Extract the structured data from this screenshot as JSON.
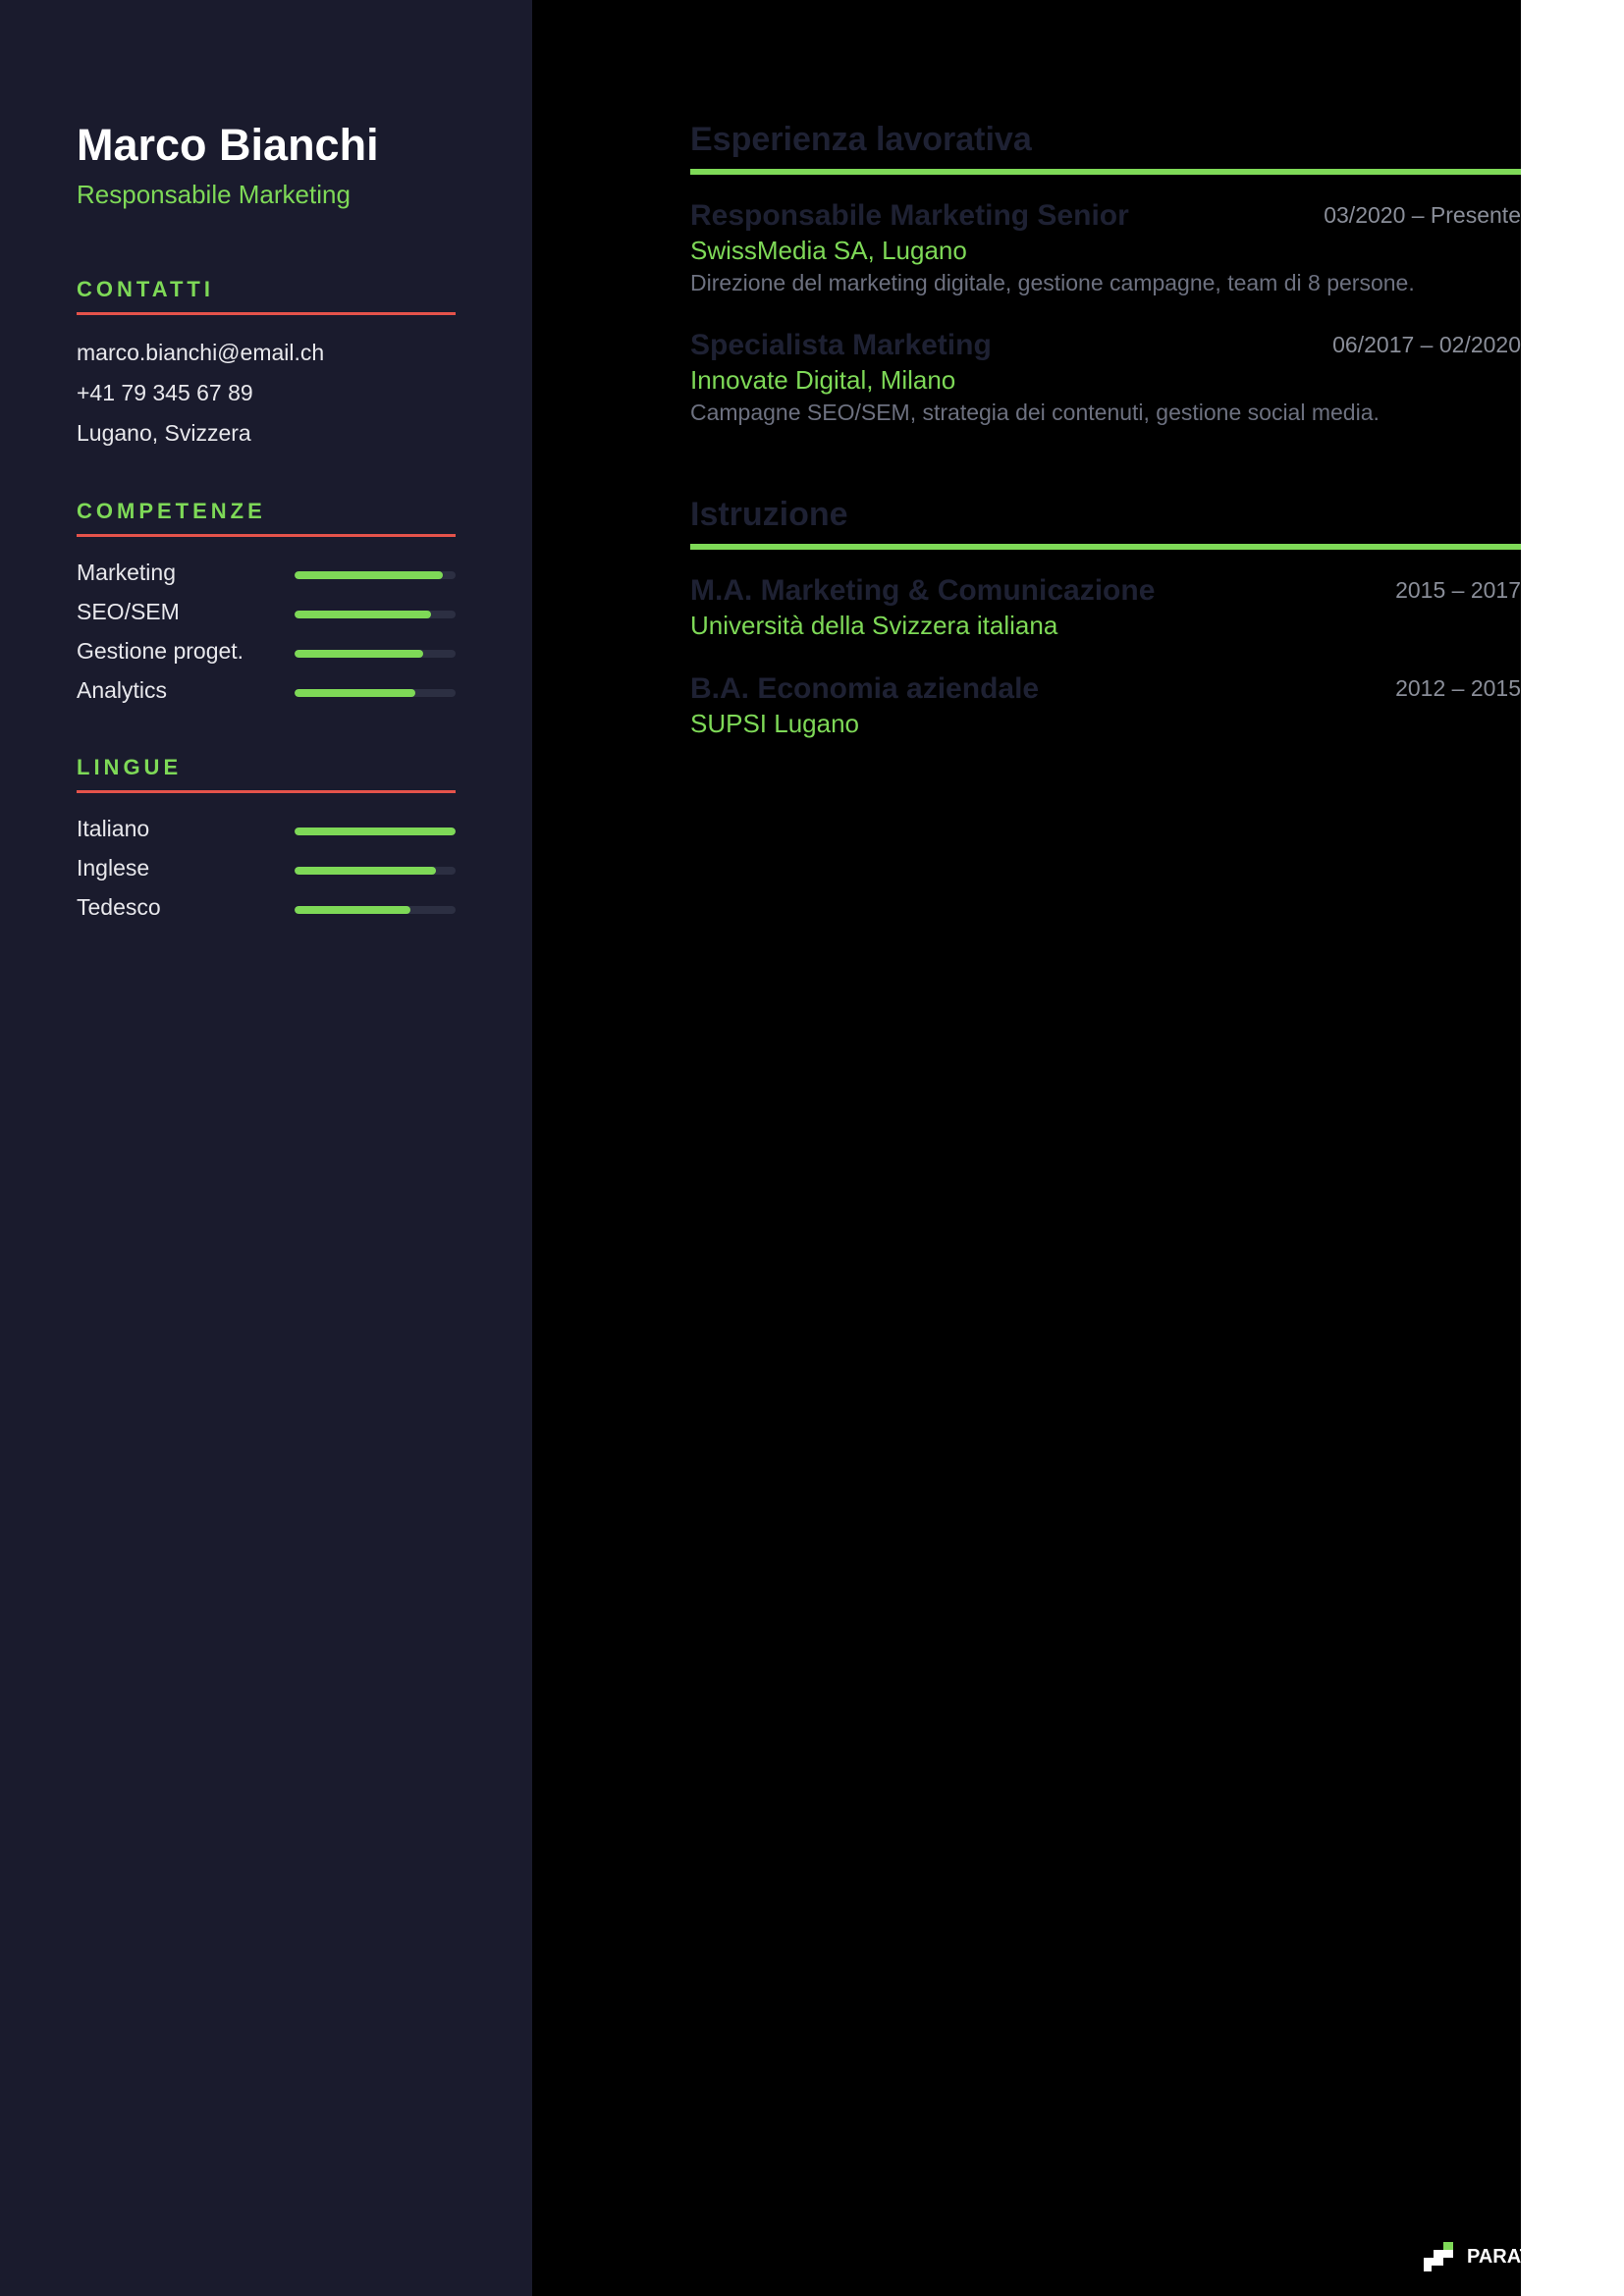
{
  "profile": {
    "name": "Marco Bianchi",
    "title": "Responsabile Marketing"
  },
  "contacts": {
    "heading": "CONTATTI",
    "email": "marco.bianchi@email.ch",
    "phone": "+41 79 345 67 89",
    "location": "Lugano, Svizzera"
  },
  "skills": {
    "heading": "COMPETENZE",
    "items": [
      {
        "label": "Marketing",
        "level": 0.92
      },
      {
        "label": "SEO/SEM",
        "level": 0.85
      },
      {
        "label": "Gestione proget.",
        "level": 0.8
      },
      {
        "label": "Analytics",
        "level": 0.75
      }
    ]
  },
  "languages": {
    "heading": "LINGUE",
    "items": [
      {
        "label": "Italiano",
        "level": 1.0
      },
      {
        "label": "Inglese",
        "level": 0.88
      },
      {
        "label": "Tedesco",
        "level": 0.72
      }
    ]
  },
  "experience": {
    "heading": "Esperienza lavorativa",
    "items": [
      {
        "title": "Responsabile Marketing Senior",
        "dates": "03/2020 – Presente",
        "org": "SwissMedia SA, Lugano",
        "description": "Direzione del marketing digitale, gestione campagne, team di 8 persone."
      },
      {
        "title": "Specialista Marketing",
        "dates": "06/2017 – 02/2020",
        "org": "Innovate Digital, Milano",
        "description": "Campagne SEO/SEM, strategia dei contenuti, gestione social media."
      }
    ]
  },
  "education": {
    "heading": "Istruzione",
    "items": [
      {
        "title": "M.A. Marketing & Comunicazione",
        "dates": "2015 – 2017",
        "org": "Università della Svizzera italiana"
      },
      {
        "title": "B.A. Economia aziendale",
        "dates": "2012 – 2015",
        "org": "SUPSI Lugano"
      }
    ]
  },
  "footer": {
    "logo_text": "PARATYPE"
  },
  "colors": {
    "sidebar_bg": "#1a1b2d",
    "accent_green": "#7ed957",
    "accent_red": "#e5534b",
    "heading_dark": "#1e2133"
  }
}
